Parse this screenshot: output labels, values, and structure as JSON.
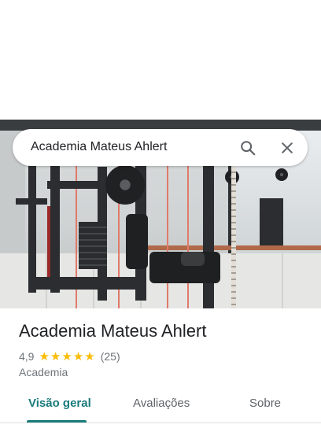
{
  "search": {
    "query": "Academia Mateus Ahlert",
    "search_icon": "search-icon",
    "close_icon": "close-icon"
  },
  "place": {
    "name": "Academia Mateus Ahlert",
    "rating": "4,9",
    "stars": 5,
    "review_count": "(25)",
    "category": "Academia"
  },
  "tabs": [
    {
      "label": "Visão geral",
      "active": true
    },
    {
      "label": "Avaliações",
      "active": false
    },
    {
      "label": "Sobre",
      "active": false
    }
  ],
  "colors": {
    "accent": "#1a7b7b",
    "star": "#fbbc04",
    "text_primary": "#202124",
    "text_secondary": "#70757a"
  }
}
